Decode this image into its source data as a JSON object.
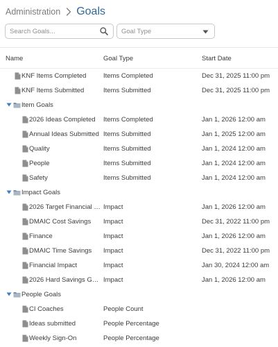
{
  "breadcrumb": {
    "parent": "Administration",
    "current": "Goals"
  },
  "search": {
    "placeholder": "Search Goals..."
  },
  "goal_type_filter": {
    "placeholder": "Goal Type"
  },
  "columns": {
    "name": "Name",
    "goal_type": "Goal Type",
    "start_date": "Start Date"
  },
  "rows": [
    {
      "kind": "item",
      "level": 0,
      "name": "KNF Items Completed",
      "type": "Items Completed",
      "date": "Dec 31, 2025 11:00 pm"
    },
    {
      "kind": "item",
      "level": 0,
      "name": "KNF Items Submitted",
      "type": "Items Submitted",
      "date": "Dec 31, 2025 11:00 pm"
    },
    {
      "kind": "folder",
      "level": 0,
      "name": "Item Goals"
    },
    {
      "kind": "item",
      "level": 1,
      "name": "2026 Ideas Completed",
      "type": "Items Completed",
      "date": "Jan 1, 2026 12:00 am"
    },
    {
      "kind": "item",
      "level": 1,
      "name": "Annual Ideas Submitted",
      "type": "Items Submitted",
      "date": "Jan 1, 2025 12:00 am"
    },
    {
      "kind": "item",
      "level": 1,
      "name": "Quality",
      "type": "Items Submitted",
      "date": "Jan 1, 2024 12:00 am"
    },
    {
      "kind": "item",
      "level": 1,
      "name": "People",
      "type": "Items Submitted",
      "date": "Jan 1, 2024 12:00 am"
    },
    {
      "kind": "item",
      "level": 1,
      "name": "Safety",
      "type": "Items Submitted",
      "date": "Jan 1, 2024 12:00 am"
    },
    {
      "kind": "folder",
      "level": 0,
      "name": "Impact Goals"
    },
    {
      "kind": "item",
      "level": 1,
      "name": "2026 Target Financial I...",
      "type": "Impact",
      "date": "Jan 1, 2026 12:00 am"
    },
    {
      "kind": "item",
      "level": 1,
      "name": "DMAIC Cost Savings",
      "type": "Impact",
      "date": "Dec 31, 2022 11:00 pm"
    },
    {
      "kind": "item",
      "level": 1,
      "name": "Finance",
      "type": "Impact",
      "date": "Jan 1, 2026 12:00 am"
    },
    {
      "kind": "item",
      "level": 1,
      "name": "DMAIC Time Savings",
      "type": "Impact",
      "date": "Dec 31, 2022 11:00 pm"
    },
    {
      "kind": "item",
      "level": 1,
      "name": "Financial Impact",
      "type": "Impact",
      "date": "Jan 30, 2024 12:00 am"
    },
    {
      "kind": "item",
      "level": 1,
      "name": "2026 Hard Savings Go...",
      "type": "Impact",
      "date": "Jan 1, 2026 12:00 am"
    },
    {
      "kind": "folder",
      "level": 0,
      "name": "People Goals"
    },
    {
      "kind": "item",
      "level": 1,
      "name": "CI Coaches",
      "type": "People Count",
      "date": ""
    },
    {
      "kind": "item",
      "level": 1,
      "name": "Ideas submitted",
      "type": "People Percentage",
      "date": ""
    },
    {
      "kind": "item",
      "level": 1,
      "name": "Weekly Sign-On",
      "type": "People Percentage",
      "date": ""
    }
  ],
  "colors": {
    "accent": "#31689a",
    "folder": "#7d8fa3",
    "expand_caret": "#3f7fc0",
    "doc_icon": "#8e8e8e"
  },
  "icons": {
    "search": "search-icon",
    "dropdown": "chevron-down-icon",
    "document": "document-icon",
    "folder": "folder-icon",
    "caret": "caret-down-icon",
    "separator": "chevron-right-icon"
  }
}
